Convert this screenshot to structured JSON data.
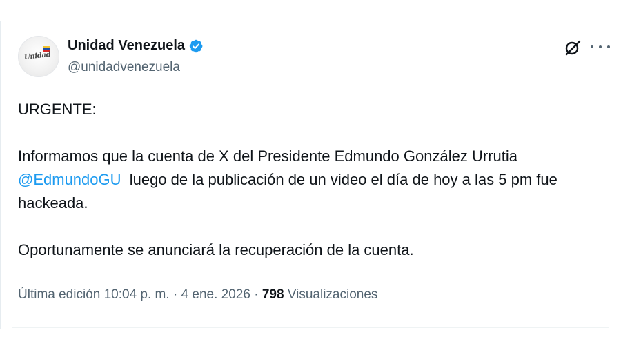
{
  "tweet": {
    "author": {
      "display_name": "Unidad Venezuela",
      "handle": "@unidadvenezuela",
      "verified": true,
      "verified_color": "#1d9bf0",
      "avatar_logo_text": "Unidad"
    },
    "header_icons": {
      "grok": "grok-icon",
      "more": "more-icon"
    },
    "text": {
      "line1": "URGENTE:",
      "para2_part1": "Informamos que la cuenta de X del Presidente Edmundo González Urrutia ",
      "mention": "@EdmundoGU",
      "para2_part2": "  luego de la publicación de un video el día de hoy a las 5 pm fue hackeada.",
      "para3": "Oportunamente se anunciará la recuperación de la cuenta."
    },
    "meta": {
      "edited_label": "Última edición 10:04 p. m. · 4 ene. 2026 · ",
      "views_count": "798",
      "views_label": " Visualizaciones"
    },
    "colors": {
      "text": "#0f1419",
      "secondary": "#536471",
      "link": "#1d9bf0"
    }
  }
}
